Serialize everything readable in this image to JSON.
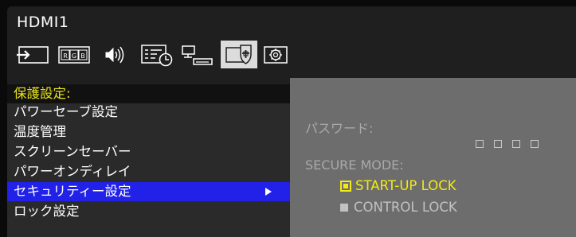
{
  "header": {
    "input_source": "HDMI1"
  },
  "toolbar": {
    "icons": [
      {
        "name": "input-icon"
      },
      {
        "name": "rgb-picture-icon",
        "text": "RGB"
      },
      {
        "name": "audio-icon"
      },
      {
        "name": "schedule-icon"
      },
      {
        "name": "pip-icon"
      },
      {
        "name": "protect-icon",
        "active": true
      },
      {
        "name": "advanced-icon"
      }
    ]
  },
  "menu": {
    "title": "保護設定:",
    "items": [
      {
        "label": "パワーセーブ設定"
      },
      {
        "label": "温度管理"
      },
      {
        "label": "スクリーンセーバー"
      },
      {
        "label": "パワーオンディレイ"
      },
      {
        "label": "セキュリティー設定",
        "selected": true
      },
      {
        "label": "ロック設定"
      }
    ]
  },
  "panel": {
    "password_label": "パスワード:",
    "password_placeholder": "□□□□",
    "secure_mode_label": "SECURE MODE:",
    "options": [
      {
        "label": "START-UP LOCK",
        "selected": true
      },
      {
        "label": "CONTROL LOCK",
        "selected": false
      }
    ]
  },
  "colors": {
    "highlight": "#f2ea12",
    "selection": "#2121e8",
    "panel_bg": "#6d6d6d"
  }
}
